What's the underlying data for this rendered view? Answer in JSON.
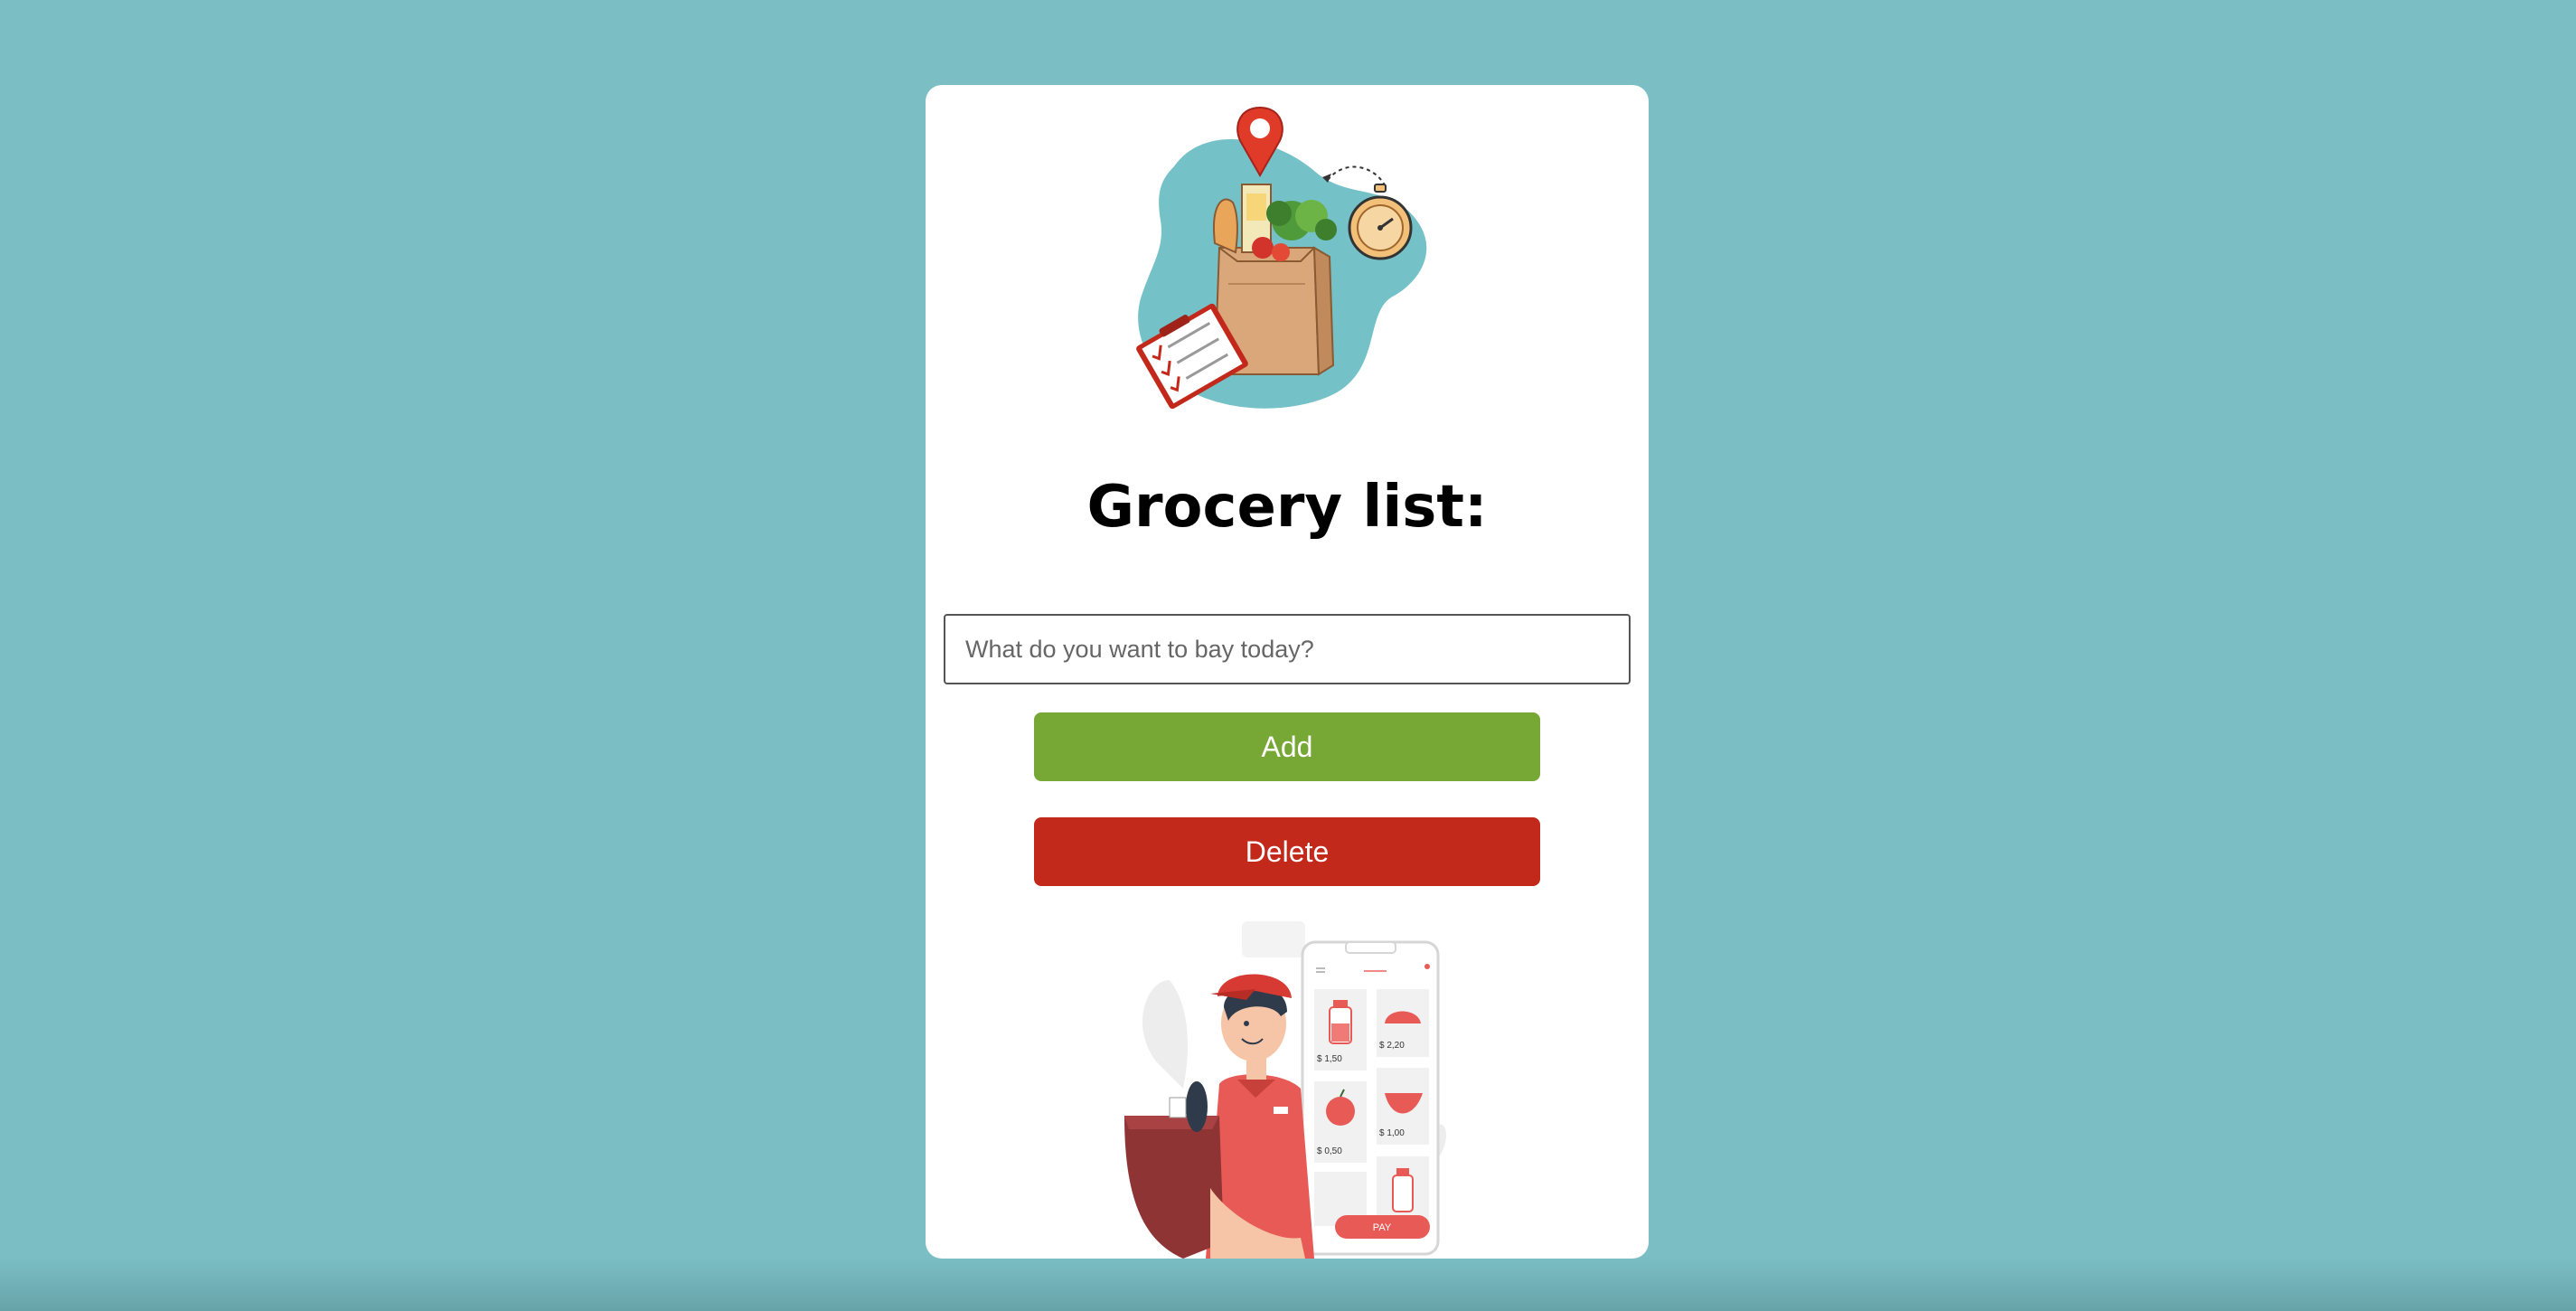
{
  "title": "Grocery list:",
  "input": {
    "placeholder": "What do you want to bay today?",
    "value": ""
  },
  "buttons": {
    "add_label": "Add",
    "delete_label": "Delete"
  },
  "phone_app": {
    "prices": [
      "$ 1,50",
      "$ 2,20",
      "$ 0,50",
      "$ 1,00"
    ],
    "pay_label": "PAY"
  },
  "colors": {
    "background": "#7bbfc5",
    "card": "#ffffff",
    "add_button": "#77a836",
    "delete_button": "#c3291b"
  },
  "icons": {
    "hero": "grocery-bag-illustration",
    "bottom": "delivery-person-illustration"
  }
}
